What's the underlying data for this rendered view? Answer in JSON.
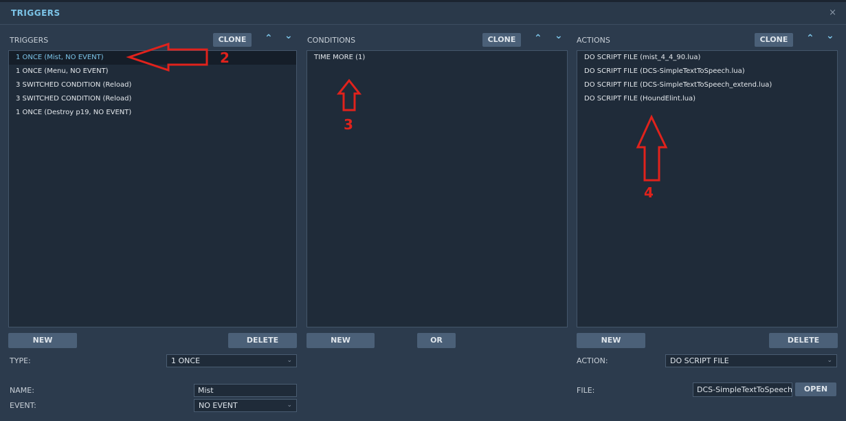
{
  "window": {
    "title": "TRIGGERS",
    "close": "×"
  },
  "triggers": {
    "header": "TRIGGERS",
    "clone": "CLONE",
    "up": "⌃",
    "down": "⌄",
    "items": [
      "1 ONCE (Mist, NO EVENT)",
      "1 ONCE (Menu, NO EVENT)",
      "3 SWITCHED CONDITION (Reload)",
      "3 SWITCHED CONDITION (Reload)",
      "1 ONCE (Destroy p19, NO EVENT)"
    ],
    "new": "NEW",
    "delete": "DELETE",
    "type_label": "TYPE:",
    "type_value": "1 ONCE",
    "name_label": "NAME:",
    "name_value": "Mist",
    "event_label": "EVENT:",
    "event_value": "NO EVENT"
  },
  "conditions": {
    "header": "CONDITIONS",
    "clone": "CLONE",
    "up": "⌃",
    "down": "⌄",
    "items": [
      "TIME MORE (1)"
    ],
    "new": "NEW",
    "or": "OR"
  },
  "actions": {
    "header": "ACTIONS",
    "clone": "CLONE",
    "up": "⌃",
    "down": "⌄",
    "items": [
      "DO SCRIPT FILE (mist_4_4_90.lua)",
      "DO SCRIPT FILE (DCS-SimpleTextToSpeech.lua)",
      "DO SCRIPT FILE (DCS-SimpleTextToSpeech_extend.lua)",
      "DO SCRIPT FILE (HoundElint.lua)"
    ],
    "new": "NEW",
    "delete": "DELETE",
    "action_label": "ACTION:",
    "action_value": "DO SCRIPT FILE",
    "file_label": "FILE:",
    "file_value": "DCS-SimpleTextToSpeech",
    "open": "OPEN"
  },
  "annotations": {
    "a2": "2",
    "a3": "3",
    "a4": "4"
  },
  "colors": {
    "accent": "#7cc4e8",
    "annotation": "#e0221c"
  }
}
